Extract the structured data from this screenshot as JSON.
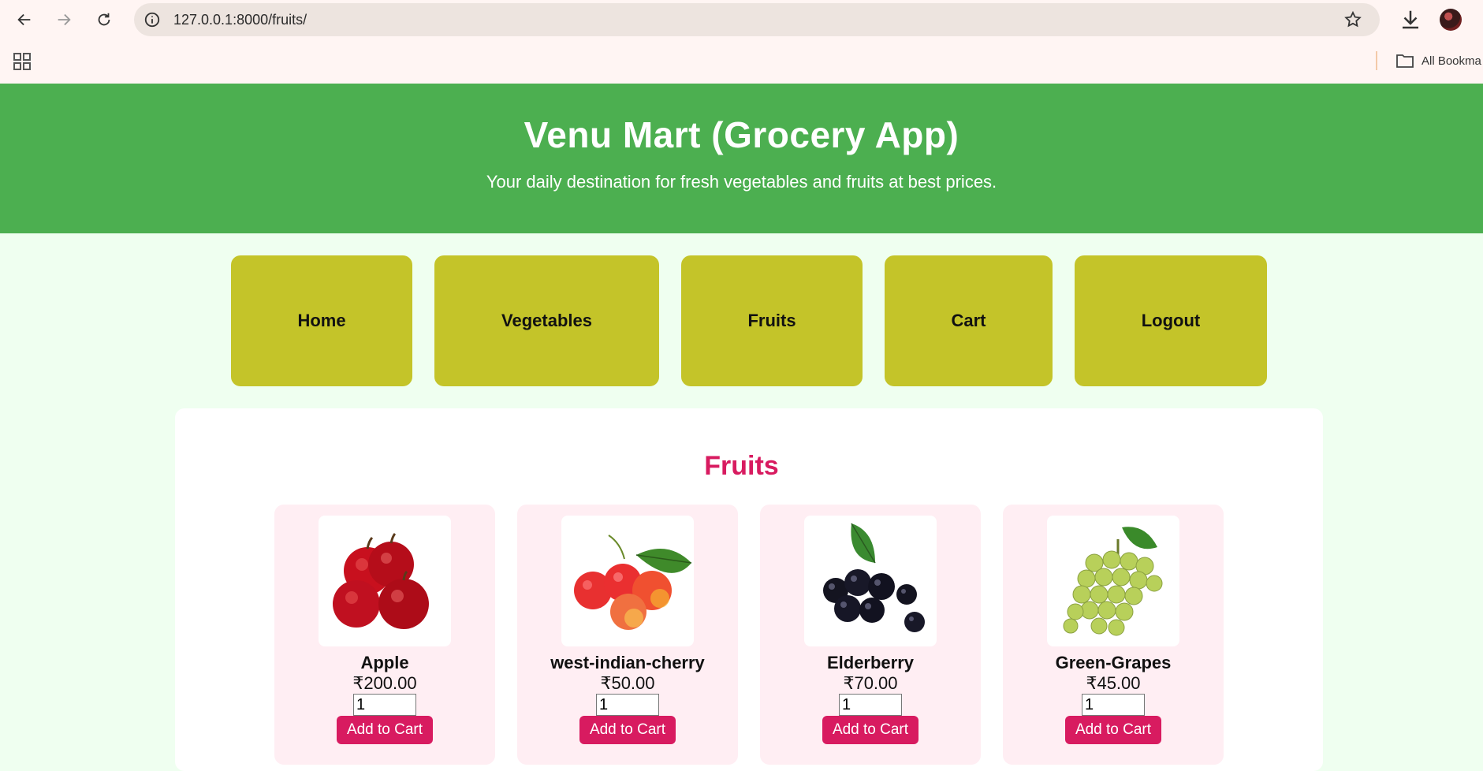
{
  "browser": {
    "url": "127.0.0.1:8000/fruits/",
    "bookmarks_label": "All Bookma"
  },
  "header": {
    "title": "Venu Mart (Grocery App)",
    "tagline": "Your daily destination for fresh vegetables and fruits at best prices."
  },
  "nav": {
    "items": [
      {
        "label": "Home"
      },
      {
        "label": "Vegetables"
      },
      {
        "label": "Fruits"
      },
      {
        "label": "Cart"
      },
      {
        "label": "Logout"
      }
    ]
  },
  "section": {
    "title": "Fruits"
  },
  "products": [
    {
      "name": "Apple",
      "price": "₹200.00",
      "qty": "1",
      "button": "Add to Cart",
      "image": "apple-image"
    },
    {
      "name": "west-indian-cherry",
      "price": "₹50.00",
      "qty": "1",
      "button": "Add to Cart",
      "image": "cherry-image"
    },
    {
      "name": "Elderberry",
      "price": "₹70.00",
      "qty": "1",
      "button": "Add to Cart",
      "image": "elderberry-image"
    },
    {
      "name": "Green-Grapes",
      "price": "₹45.00",
      "qty": "1",
      "button": "Add to Cart",
      "image": "grapes-image"
    }
  ],
  "colors": {
    "header_bg": "#4caf50",
    "nav_tile": "#c4c429",
    "accent": "#d81b60",
    "card_bg": "#ffeef3",
    "page_bg": "#effff0"
  }
}
